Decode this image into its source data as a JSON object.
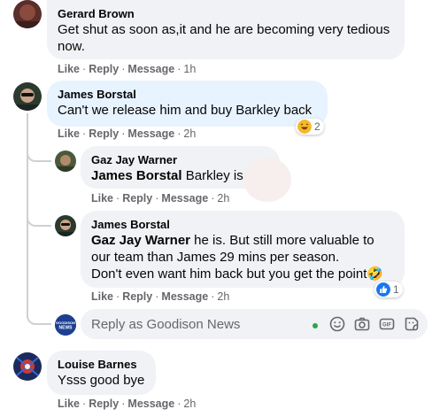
{
  "actions": {
    "like": "Like",
    "reply": "Reply",
    "message": "Message",
    "separator": "·"
  },
  "comments": [
    {
      "author": "Gerard Brown",
      "text": "Get shut as soon as,it and he are becoming very tedious now.",
      "time": "1h"
    },
    {
      "author": "James Borstal",
      "text": "Can't we release him and buy Barkley back",
      "time": "2h",
      "reaction_count": "2",
      "reaction_icon": "haha-icon"
    },
    {
      "author": "Gaz Jay Warner",
      "mention": "James Borstal",
      "text": "Barkley is",
      "time": "2h"
    },
    {
      "author": "James Borstal",
      "mention": "Gaz Jay Warner",
      "text": "he is. But still more valuable to our team than James 29 mins per season.",
      "text2": "Don't even want him back but you get the point🤣",
      "time": "2h",
      "reaction_count": "1",
      "reaction_icon": "like-icon"
    },
    {
      "author": "Louise Barnes",
      "text": "Ysss good bye",
      "time": "2h"
    }
  ],
  "reply_box": {
    "placeholder": "Reply as Goodison News",
    "page_avatar_text": "GOODISON NEWS"
  },
  "colors": {
    "bubble": "#f0f2f5",
    "highlight_bubble": "#e7f3ff",
    "secondary_text": "#65676b",
    "like_blue": "#1877f2",
    "haha_yellow": "#f7b928",
    "online_green": "#31a24c",
    "goodison_blue": "#1d3f8f"
  }
}
